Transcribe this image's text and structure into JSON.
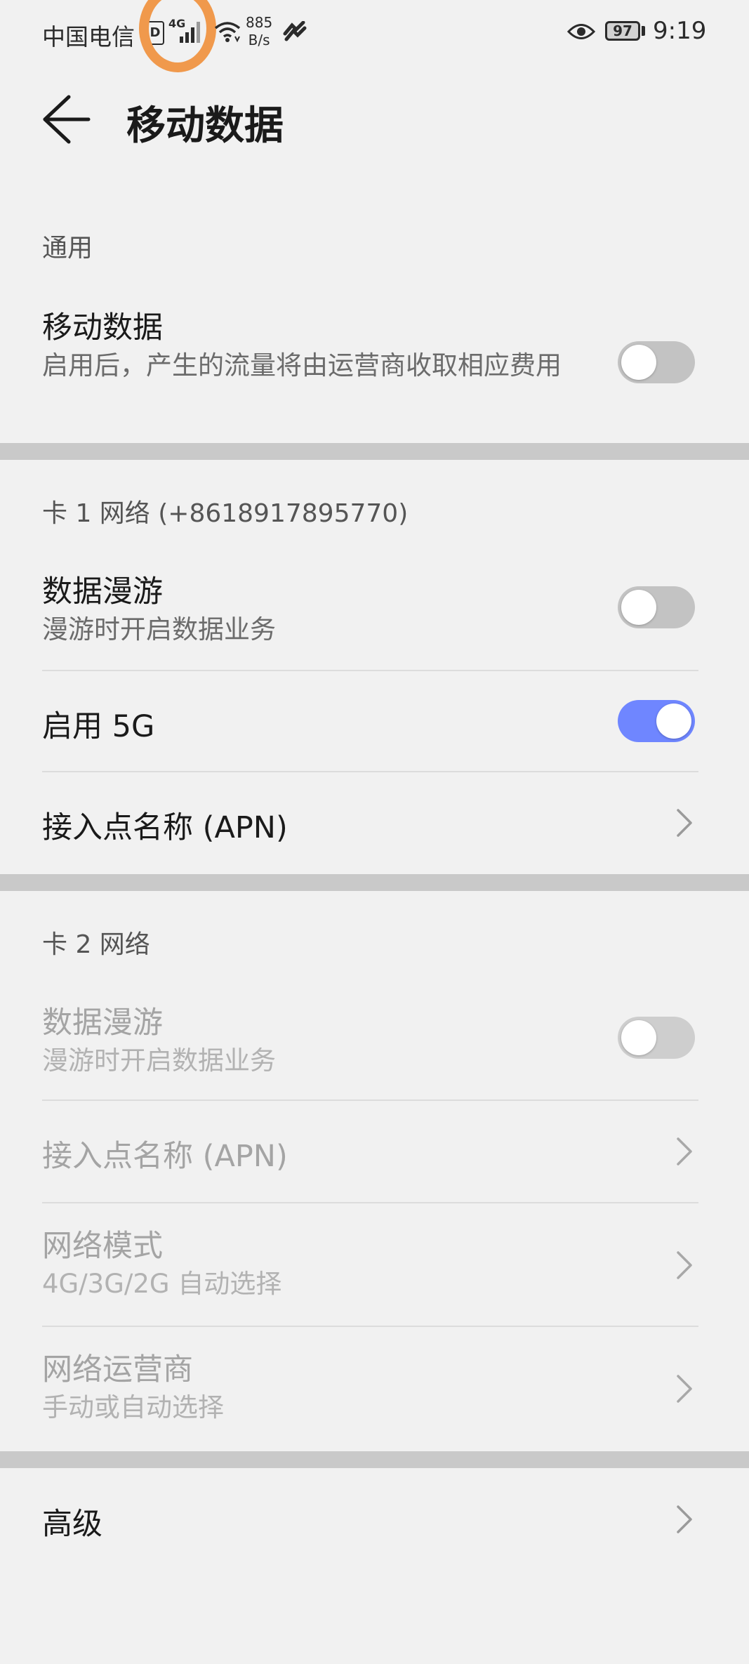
{
  "status_bar": {
    "carrier": "中国电信",
    "sim_label": "D",
    "network_type": "4G",
    "speed_value": "885",
    "speed_unit": "B/s",
    "battery": "97",
    "time": "9:19",
    "highlight_color": "#f0994c"
  },
  "header": {
    "title": "移动数据",
    "back_icon": "arrow-left-icon"
  },
  "general": {
    "heading": "通用",
    "mobile_data": {
      "title": "移动数据",
      "subtitle": "启用后，产生的流量将由运营商收取相应费用",
      "enabled": false
    }
  },
  "card1": {
    "heading": "卡 1 网络 (+8618917895770)",
    "roaming": {
      "title": "数据漫游",
      "subtitle": "漫游时开启数据业务",
      "enabled": false
    },
    "enable_5g": {
      "title": "启用 5G",
      "enabled": true
    },
    "apn": {
      "title": "接入点名称 (APN)"
    }
  },
  "card2": {
    "heading": "卡 2 网络",
    "roaming": {
      "title": "数据漫游",
      "subtitle": "漫游时开启数据业务",
      "enabled": false
    },
    "apn": {
      "title": "接入点名称 (APN)"
    },
    "network_mode": {
      "title": "网络模式",
      "subtitle": "4G/3G/2G 自动选择"
    },
    "operator": {
      "title": "网络运营商",
      "subtitle": "手动或自动选择"
    }
  },
  "advanced": {
    "title": "高级"
  },
  "colors": {
    "toggle_on": "#6f86ff",
    "toggle_off": "#c3c3c3",
    "background": "#f1f1f1"
  }
}
